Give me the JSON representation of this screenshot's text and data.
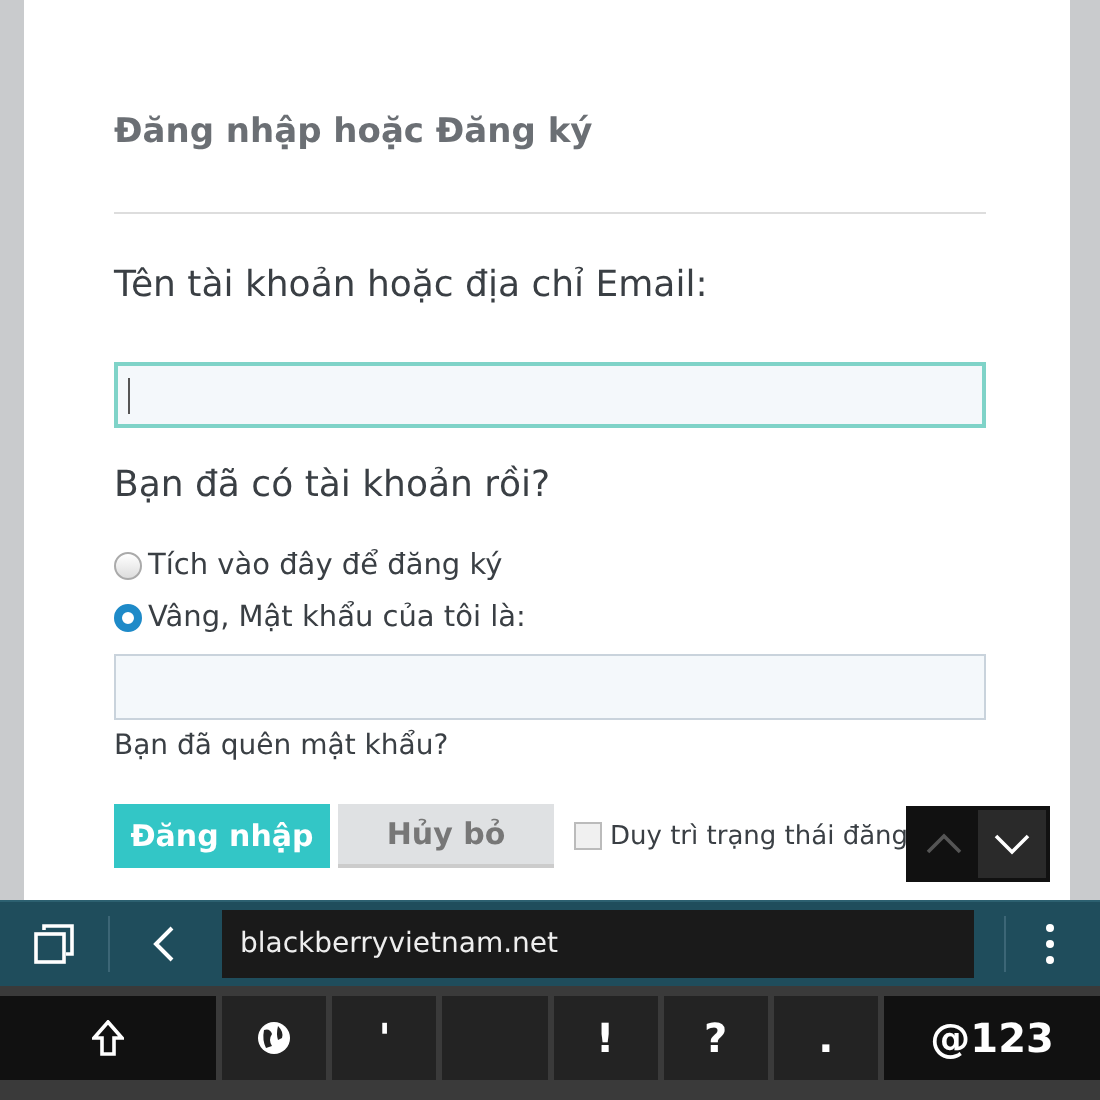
{
  "form": {
    "title": "Đăng nhập hoặc Đăng ký",
    "email_label": "Tên tài khoản hoặc địa chỉ Email:",
    "email_field": {
      "focused": true
    },
    "question": "Bạn đã có tài khoản rồi?",
    "options": [
      {
        "label": "Tích vào đây để đăng ký",
        "selected": false
      },
      {
        "label": "Vâng, Mật khẩu của tôi là:",
        "selected": true
      }
    ],
    "forgot_link": "Bạn đã quên mật khẩu?",
    "buttons": [
      {
        "label": "Đăng nhập",
        "kind": "primary"
      },
      {
        "label": "Hủy bỏ",
        "kind": "secondary"
      }
    ],
    "remember": {
      "label": "Duy trì trạng thái đăng",
      "checked": false
    }
  },
  "find_bar": [
    {
      "kind": "up",
      "disabled": true
    },
    {
      "kind": "down",
      "disabled": false
    }
  ],
  "browser_bar": {
    "url": "blackberryvietnam.net"
  },
  "keyboard": [
    {
      "kind": "shift"
    },
    {
      "kind": "globe"
    },
    {
      "kind": "char",
      "label": "'"
    },
    {
      "kind": "blank"
    },
    {
      "kind": "char",
      "label": "!"
    },
    {
      "kind": "char",
      "label": "?"
    },
    {
      "kind": "char",
      "label": "."
    },
    {
      "kind": "wide",
      "label": "@123"
    }
  ]
}
